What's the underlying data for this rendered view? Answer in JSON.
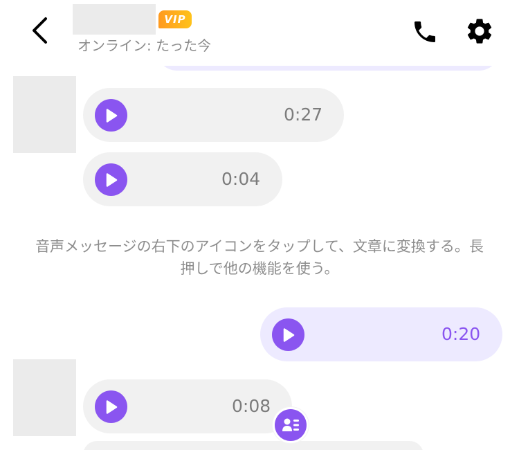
{
  "header": {
    "vip_label": "VIP",
    "status": "オンライン: たった今",
    "icons": {
      "back": "chevron-left-icon",
      "phone": "phone-icon",
      "settings": "gear-icon"
    }
  },
  "messages": [
    {
      "direction": "incoming",
      "type": "voice",
      "duration": "0:27"
    },
    {
      "direction": "incoming",
      "type": "voice",
      "duration": "0:04"
    },
    {
      "direction": "outgoing",
      "type": "voice",
      "duration": "0:20"
    },
    {
      "direction": "incoming",
      "type": "voice",
      "duration": "0:08"
    }
  ],
  "system_note": "音声メッセージの右下のアイコンをタップして、文章に変換する。長押しで他の機能を使う。",
  "colors": {
    "accent": "#8a55f0",
    "incoming_bubble": "#f1f1f1",
    "outgoing_bubble": "#edeaff",
    "vip_gradient_start": "#ff9a1f",
    "vip_gradient_end": "#ffc21a"
  }
}
